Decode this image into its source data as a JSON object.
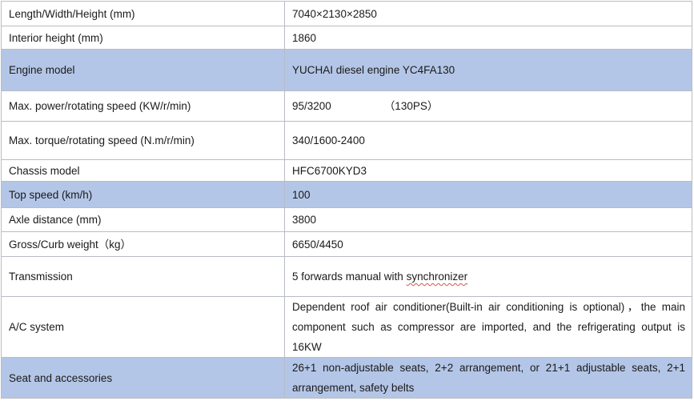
{
  "rows": [
    {
      "label": "Length/Width/Height (mm)",
      "value": "7040×2130×2850"
    },
    {
      "label": "Interior height (mm)",
      "value": "1860"
    },
    {
      "label": "Engine model",
      "value": "YUCHAI diesel engine YC4FA130"
    },
    {
      "label": "Max. power/rotating speed (KW/r/min)",
      "value": "95/3200",
      "value_extra": "（130PS）"
    },
    {
      "label": "Max. torque/rotating speed (N.m/r/min)",
      "value": "340/1600-2400"
    },
    {
      "label": "Chassis model",
      "value": "HFC6700KYD3"
    },
    {
      "label": "Top speed (km/h)",
      "value": "100"
    },
    {
      "label": "Axle distance (mm)",
      "value": "3800"
    },
    {
      "label": "Gross/Curb weight（kg）",
      "value": "6650/4450"
    },
    {
      "label": "Transmission",
      "value": "5 forwards manual with ",
      "value_extra": "synchronizer"
    },
    {
      "label": "A/C system",
      "value": "Dependent roof air conditioner(Built-in air conditioning is optional)，the main component such as compressor are imported, and the refrigerating output is 16KW"
    },
    {
      "label": "Seat and accessories",
      "value": "26+1 non-adjustable seats, 2+2 arrangement, or 21+1 adjustable seats, 2+1 arrangement, safety belts"
    }
  ],
  "colors": {
    "highlight_row": "#b4c6e7",
    "border": "#b8bcc4",
    "spellcheck_underline": "#d9534f"
  }
}
